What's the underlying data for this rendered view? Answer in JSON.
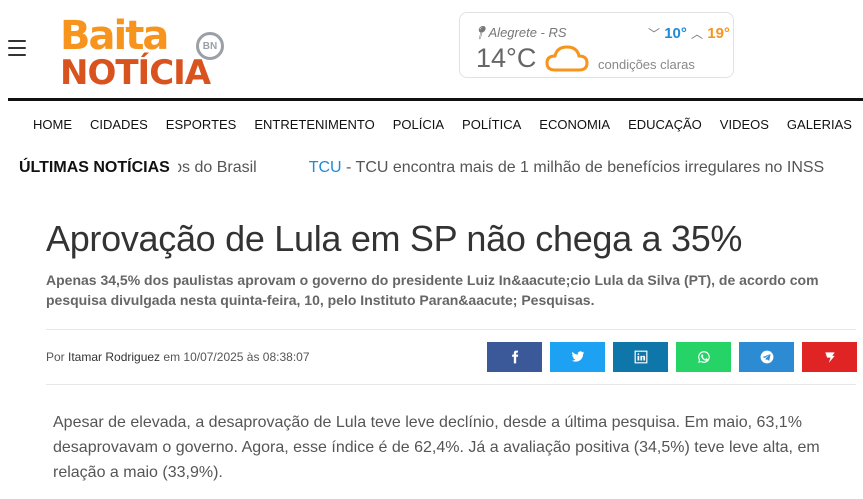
{
  "header": {
    "logo_line1": "Baita",
    "logo_line2": "NOTÍCIA",
    "logo_badge": "BN"
  },
  "weather": {
    "location": "Alegrete - RS",
    "temperature": "14°C",
    "min": "10°",
    "max": "19°",
    "condition": "condições claras",
    "icon": "cloud-icon"
  },
  "nav": {
    "items": [
      "HOME",
      "CIDADES",
      "ESPORTES",
      "ENTRETENIMENTO",
      "POLÍCIA",
      "POLÍTICA",
      "ECONOMIA",
      "EDUCAÇÃO",
      "VIDEOS",
      "GALERIAS"
    ]
  },
  "ticker": {
    "label": "ÚLTIMAS NOTÍCIAS",
    "prev_fragment": "egros do Brasil",
    "tag": "TCU",
    "separator": " - ",
    "headline": "TCU encontra mais de 1 milhão de benefícios irregulares no INSS"
  },
  "article": {
    "title": "Aprovação de Lula em SP não chega a 35%",
    "subtitle": "Apenas 34,5% dos paulistas aprovam o governo do presidente Luiz In&aacute;cio Lula da Silva (PT), de acordo com pesquisa divulgada nesta quinta-feira, 10, pelo Instituto Paran&aacute; Pesquisas.",
    "byline_prefix": "Por ",
    "author": "Itamar Rodriguez",
    "date_text": " em 10/07/2025 às 08:38:07",
    "body": "Apesar de elevada, a desaprovação de Lula teve leve declínio, desde a última pesquisa. Em maio, 63,1% desaprovavam o governo. Agora, esse índice é de 62,4%. Já a avaliação positiva (34,5%) teve leve alta, em relação a maio (33,9%)."
  },
  "share": {
    "colors": {
      "facebook": "#3b5998",
      "twitter": "#1da1f2",
      "linkedin": "#0e76a8",
      "whatsapp": "#25d366",
      "telegram": "#2c8bd2",
      "other": "#e02424"
    }
  }
}
